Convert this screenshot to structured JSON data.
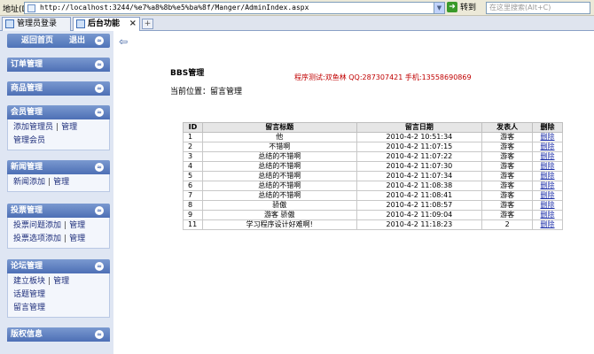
{
  "browser": {
    "address_label": "地址(D)",
    "url": "http://localhost:3244/%e7%a8%8b%e5%ba%8f/Manger/AdminIndex.aspx",
    "go_label": "转到",
    "search_placeholder": "在这里搜索(Alt+C)",
    "tabs": [
      {
        "label": "管理员登录"
      },
      {
        "label": "后台功能"
      }
    ]
  },
  "sidebar": {
    "top": {
      "home": "返回首页",
      "logout": "退出"
    },
    "sections": [
      {
        "title": "订单管理",
        "rows": []
      },
      {
        "title": "商品管理",
        "rows": []
      },
      {
        "title": "会员管理",
        "rows": [
          [
            "添加管理员",
            "管理"
          ],
          [
            "管理会员"
          ]
        ]
      },
      {
        "title": "新闻管理",
        "rows": [
          [
            "新闻添加",
            "管理"
          ]
        ]
      },
      {
        "title": "投票管理",
        "rows": [
          [
            "投票问题添加",
            "管理"
          ],
          [
            "投票选项添加",
            "管理"
          ]
        ]
      },
      {
        "title": "论坛管理",
        "rows": [
          [
            "建立板块",
            "管理"
          ],
          [
            "话题管理"
          ],
          [
            "留言管理"
          ]
        ]
      },
      {
        "title": "版权信息",
        "rows": []
      }
    ]
  },
  "main": {
    "title": "BBS管理",
    "tester": "程序测试:双鱼林 QQ:287307421 手机:13558690869",
    "location": "当前位置：留言管理",
    "table": {
      "headers": [
        "ID",
        "留言标题",
        "留言日期",
        "发表人",
        "删除"
      ],
      "rows": [
        [
          "1",
          "他",
          "2010-4-2 10:51:34",
          "游客",
          "删除"
        ],
        [
          "2",
          "不错啊",
          "2010-4-2 11:07:15",
          "游客",
          "删除"
        ],
        [
          "3",
          "总结的不错啊",
          "2010-4-2 11:07:22",
          "游客",
          "删除"
        ],
        [
          "4",
          "总结的不错啊",
          "2010-4-2 11:07:30",
          "游客",
          "删除"
        ],
        [
          "5",
          "总结的不错啊",
          "2010-4-2 11:07:34",
          "游客",
          "删除"
        ],
        [
          "6",
          "总结的不错啊",
          "2010-4-2 11:08:38",
          "游客",
          "删除"
        ],
        [
          "7",
          "总结的不错啊",
          "2010-4-2 11:08:41",
          "游客",
          "删除"
        ],
        [
          "8",
          "骄傲",
          "2010-4-2 11:08:57",
          "游客",
          "删除"
        ],
        [
          "9",
          "游客 骄傲",
          "2010-4-2 11:09:04",
          "游客",
          "删除"
        ],
        [
          "11",
          "学习程序设计好难啊!",
          "2010-4-2 11:18:23",
          "2",
          "删除"
        ]
      ]
    }
  }
}
